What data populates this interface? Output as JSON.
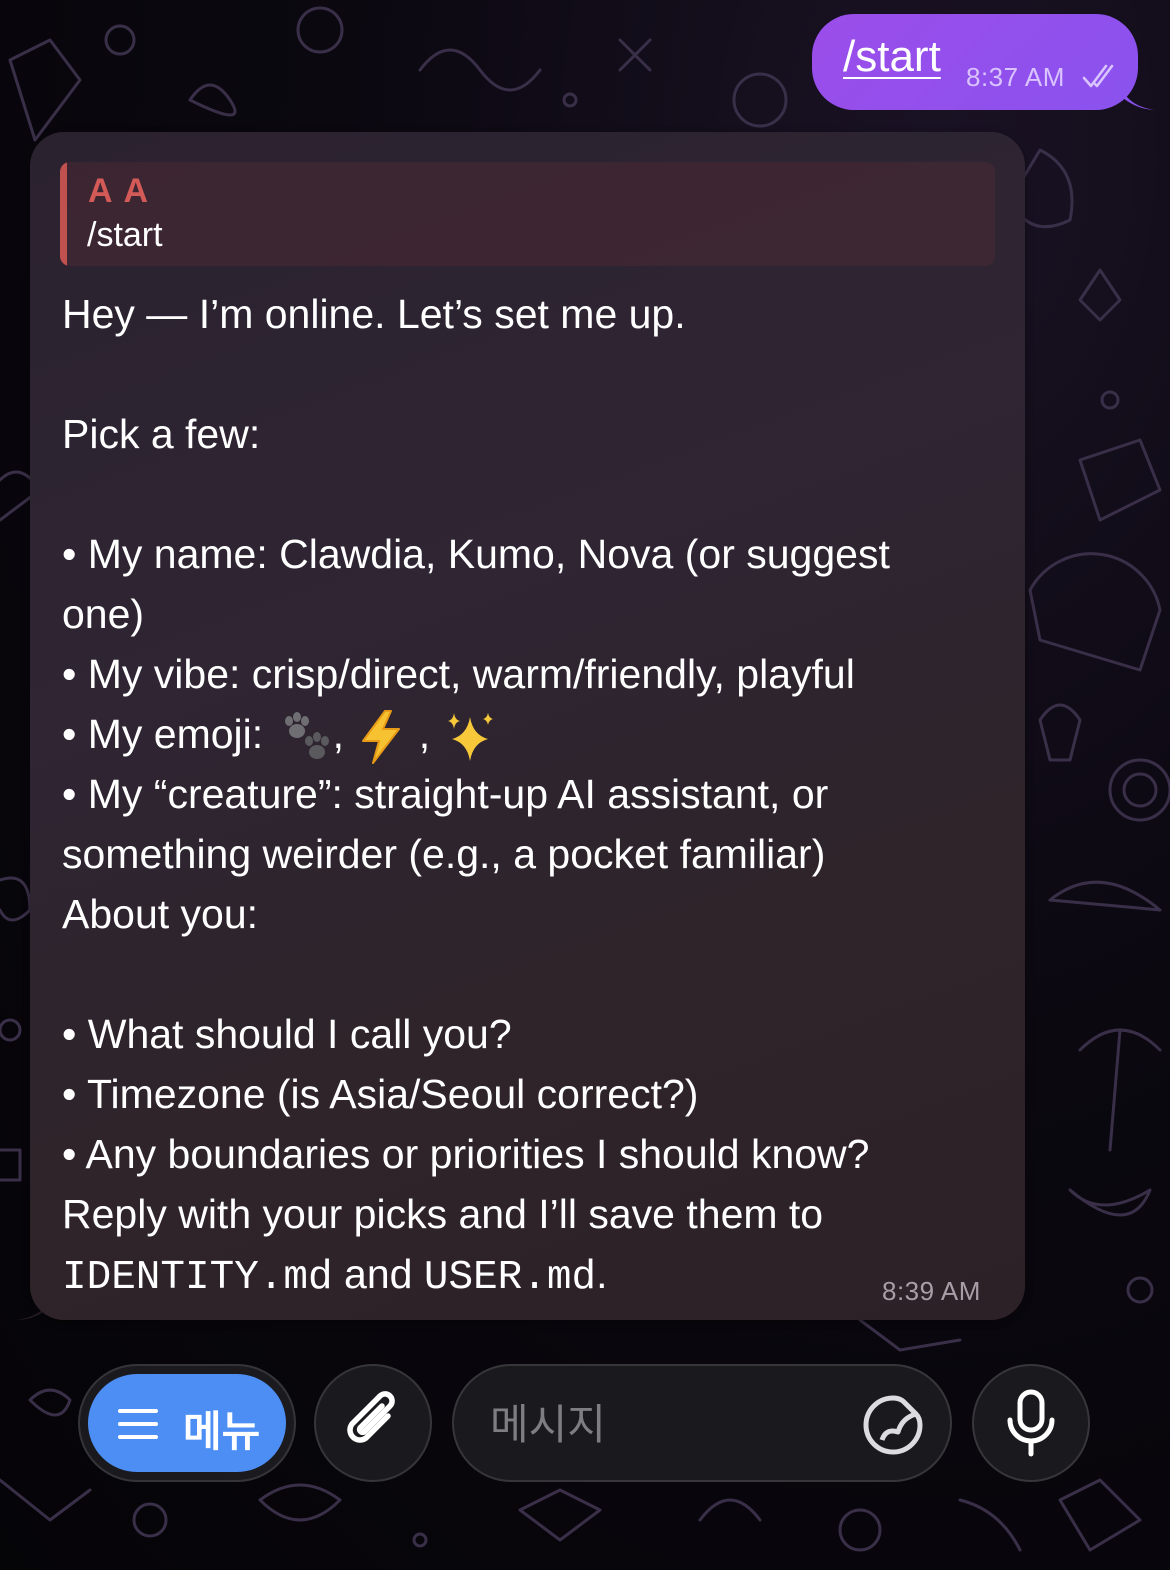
{
  "outgoing": {
    "text": "/start",
    "time": "8:37 AM",
    "status_icon": "double-check-icon",
    "bubble_color": "#9b4dea"
  },
  "incoming": {
    "reply": {
      "sender": "A A",
      "text": "/start",
      "accent_color": "#d35a56"
    },
    "lines": {
      "l1": "Hey — I’m online. Let’s set me up.",
      "l2": "Pick a few:",
      "l3": "• My name: Clawdia, Kumo, Nova (or suggest",
      "l4": "one)",
      "l5": "• My vibe: crisp/direct, warm/friendly, playful",
      "l6_prefix": "• My emoji: ",
      "emoji_1": "paw-prints-icon",
      "sep_1": ", ",
      "emoji_2": "lightning-icon",
      "sep_2": " , ",
      "emoji_3": "sparkles-icon",
      "l7": "• My “creature”: straight-up AI assistant, or",
      "l8": "something weirder (e.g., a pocket familiar)",
      "l9": "About you:",
      "l10": "• What should I call you?",
      "l11": "• Timezone (is Asia/Seoul correct?)",
      "l12": "• Any boundaries or priorities I should know?",
      "l13": "Reply with your picks and I’ll save them to",
      "l14_code1": "IDENTITY.md",
      "l14_mid": " and ",
      "l14_code2": "USER.md",
      "l14_end": "."
    },
    "time": "8:39 AM"
  },
  "input_bar": {
    "menu_label": "메뉴",
    "menu_icon": "hamburger-icon",
    "menu_color": "#4d8ef5",
    "attach_icon": "paperclip-icon",
    "placeholder": "메시지",
    "sticker_icon": "sticker-icon",
    "mic_icon": "microphone-icon"
  }
}
